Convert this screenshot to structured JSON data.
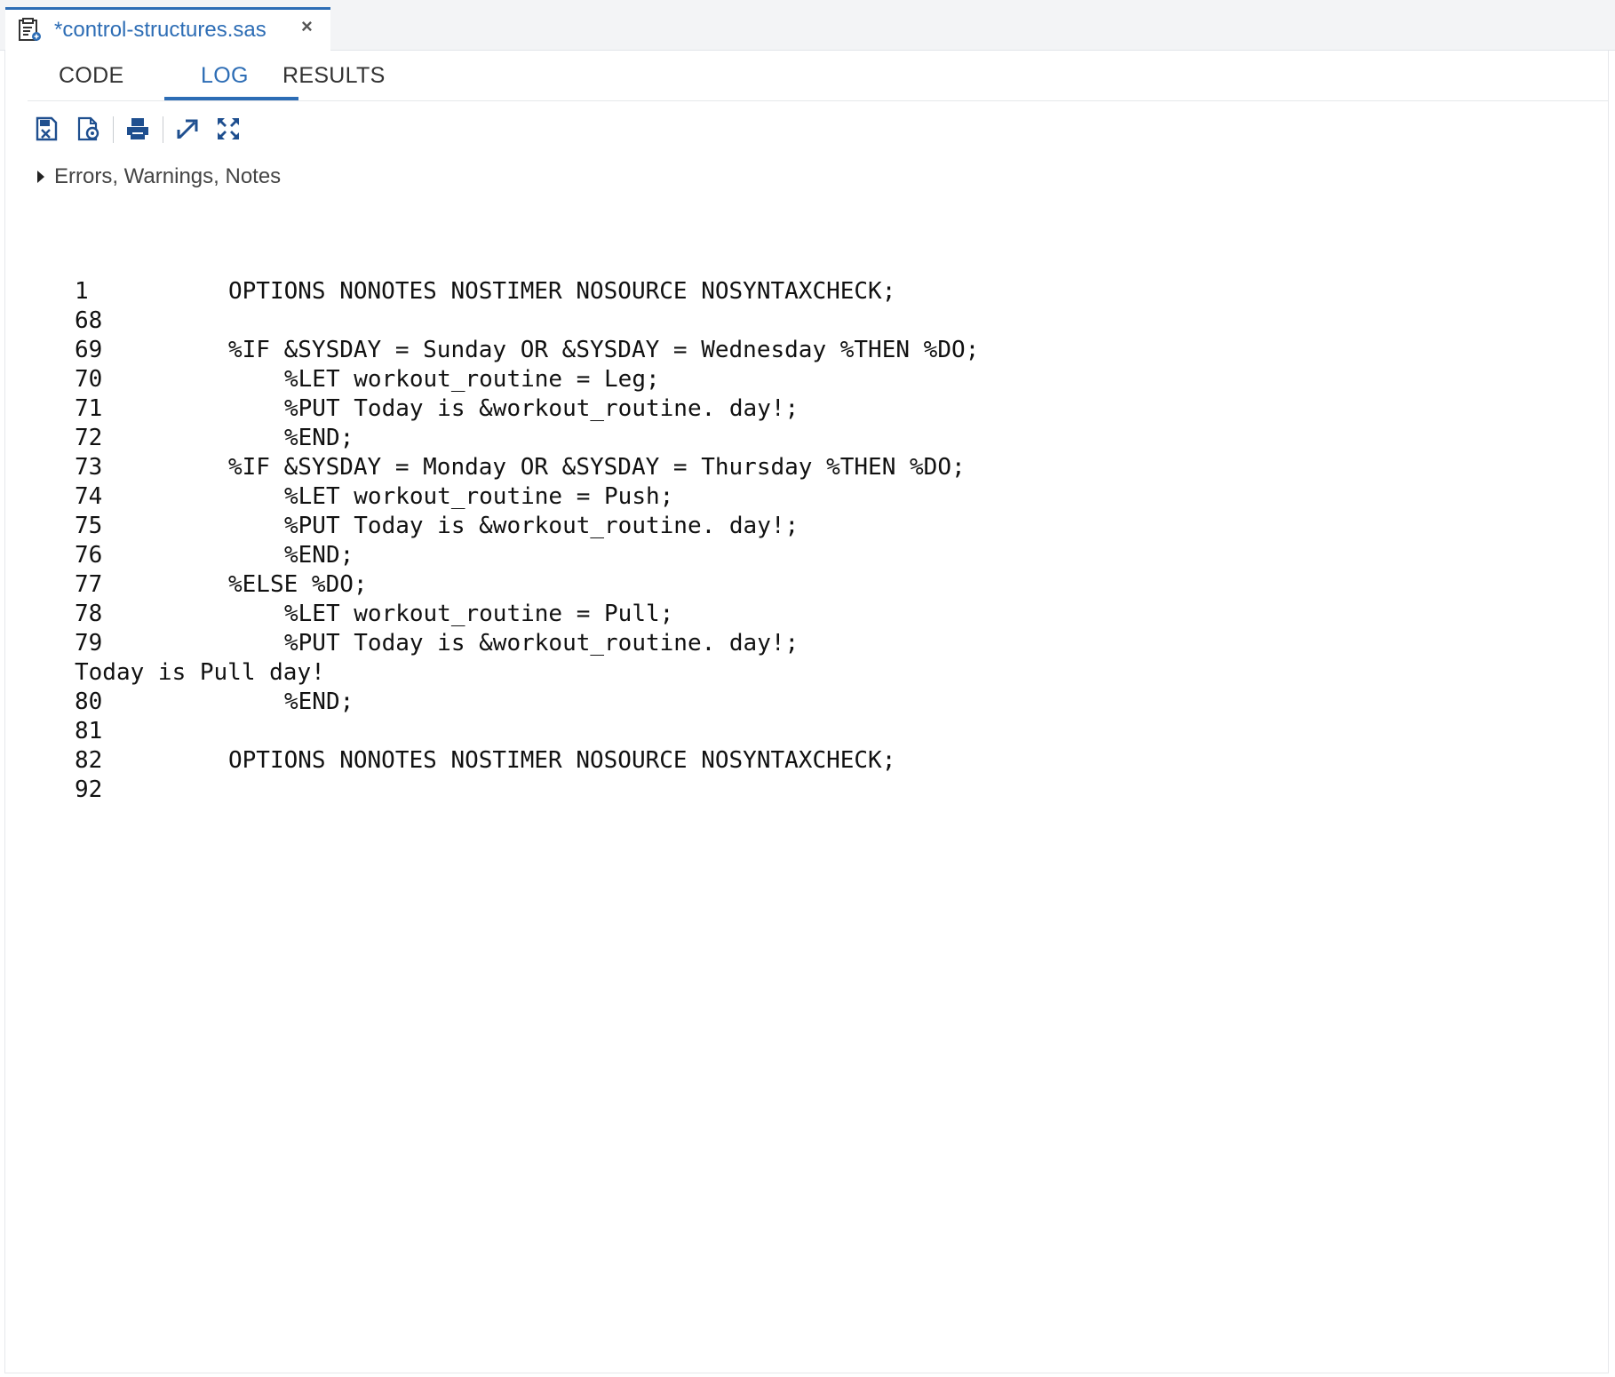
{
  "document_tab": {
    "file_name": "*control-structures.sas",
    "file_icon": "sas-program-file-icon",
    "close_label": "×"
  },
  "view_tabs": [
    {
      "label": "CODE",
      "active": false
    },
    {
      "label": "LOG",
      "active": true
    },
    {
      "label": "RESULTS",
      "active": false
    }
  ],
  "toolbar": {
    "buttons": [
      {
        "icon": "save-log-icon"
      },
      {
        "icon": "log-settings-icon"
      },
      {
        "icon": "print-icon"
      },
      {
        "icon": "popout-icon"
      },
      {
        "icon": "maximize-icon"
      }
    ]
  },
  "messages_section": {
    "label": "Errors, Warnings, Notes",
    "expanded": false
  },
  "log": {
    "lines": [
      {
        "num": "1",
        "indent": 1,
        "code": "OPTIONS NONOTES NOSTIMER NOSOURCE NOSYNTAXCHECK;"
      },
      {
        "num": "68",
        "indent": 1,
        "code": ""
      },
      {
        "num": "69",
        "indent": 1,
        "code": "%IF &SYSDAY = Sunday OR &SYSDAY = Wednesday %THEN %DO;"
      },
      {
        "num": "70",
        "indent": 2,
        "code": "%LET workout_routine = Leg;"
      },
      {
        "num": "71",
        "indent": 2,
        "code": "%PUT Today is &workout_routine. day!;"
      },
      {
        "num": "72",
        "indent": 2,
        "code": "%END;"
      },
      {
        "num": "73",
        "indent": 1,
        "code": "%IF &SYSDAY = Monday OR &SYSDAY = Thursday %THEN %DO;"
      },
      {
        "num": "74",
        "indent": 2,
        "code": "%LET workout_routine = Push;"
      },
      {
        "num": "75",
        "indent": 2,
        "code": "%PUT Today is &workout_routine. day!;"
      },
      {
        "num": "76",
        "indent": 2,
        "code": "%END;"
      },
      {
        "num": "77",
        "indent": 1,
        "code": "%ELSE %DO;"
      },
      {
        "num": "78",
        "indent": 2,
        "code": "%LET workout_routine = Pull;"
      },
      {
        "num": "79",
        "indent": 2,
        "code": "%PUT Today is &workout_routine. day!;"
      },
      {
        "num": "",
        "indent": 0,
        "code": "Today is Pull day!"
      },
      {
        "num": "80",
        "indent": 2,
        "code": "%END;"
      },
      {
        "num": "81",
        "indent": 1,
        "code": ""
      },
      {
        "num": "82",
        "indent": 1,
        "code": "OPTIONS NONOTES NOSTIMER NOSOURCE NOSYNTAXCHECK;"
      },
      {
        "num": "92",
        "indent": 1,
        "code": ""
      }
    ]
  },
  "colors": {
    "accent": "#2d6db5",
    "text": "#333333",
    "log_text": "#111111",
    "icon_blue": "#1f4f8f"
  }
}
